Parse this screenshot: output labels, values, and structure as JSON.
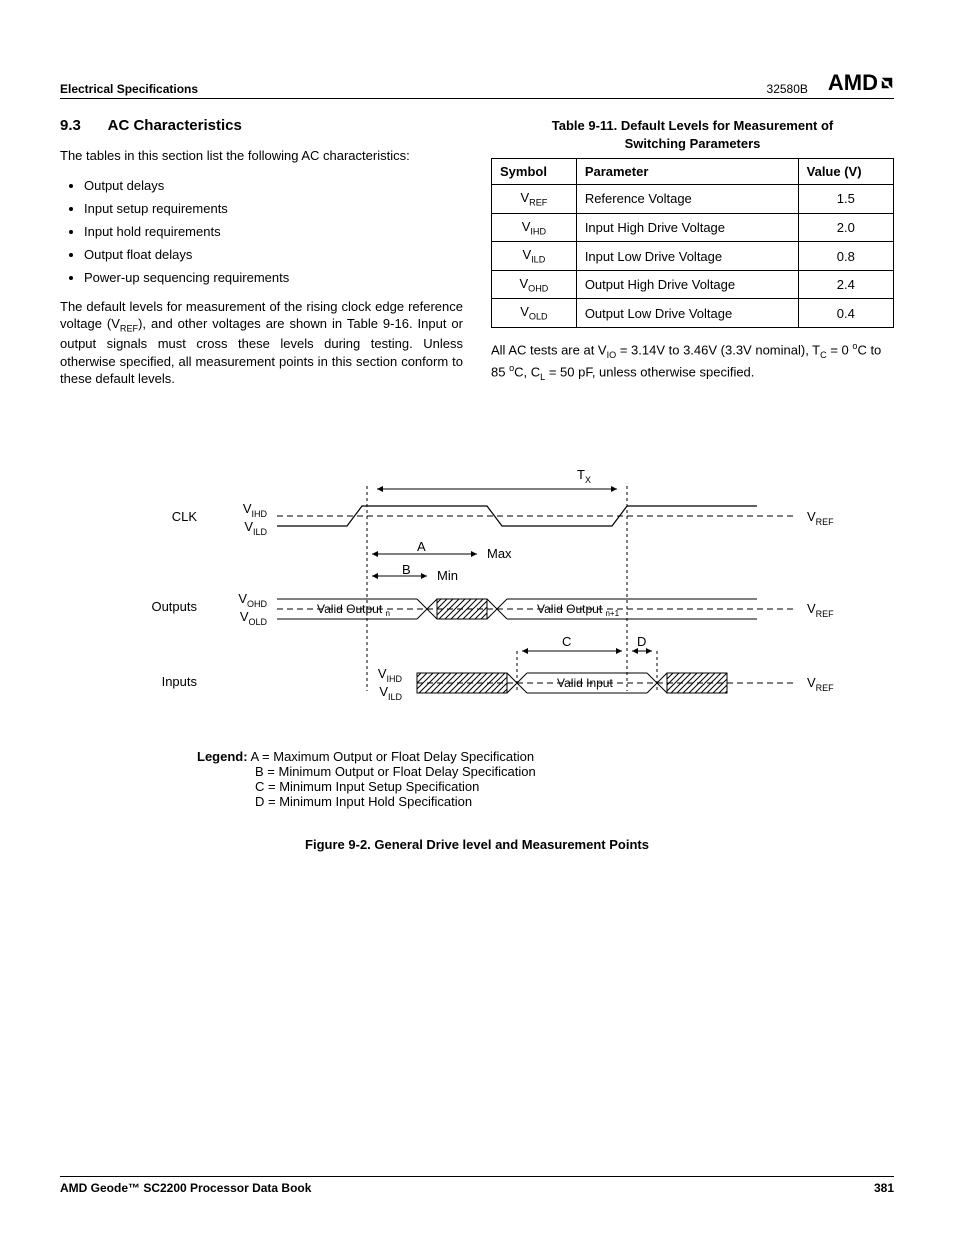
{
  "header": {
    "left": "Electrical Specifications",
    "docnum": "32580B",
    "brand": "AMD"
  },
  "footer": {
    "left": "AMD Geode™ SC2200  Processor Data Book",
    "right": "381"
  },
  "section": {
    "number": "9.3",
    "title": "AC Characteristics",
    "intro": "The tables in this section list the following AC characteristics:",
    "bullets": [
      "Output delays",
      "Input setup requirements",
      "Input hold requirements",
      "Output float delays",
      "Power-up sequencing requirements"
    ],
    "para2_a": "The default levels for measurement of the rising clock edge reference voltage (V",
    "para2_sub": "REF",
    "para2_b": "), and other voltages are shown in Table 9-16. Input or output signals must cross these levels during testing. Unless otherwise specified, all measurement points in this section conform to these default levels."
  },
  "table": {
    "caption_a": "Table 9-11.  Default Levels for Measurement of",
    "caption_b": "Switching Parameters",
    "headers": {
      "c1": "Symbol",
      "c2": "Parameter",
      "c3": "Value (V)"
    },
    "rows": [
      {
        "sym_main": "V",
        "sym_sub": "REF",
        "param": "Reference Voltage",
        "val": "1.5"
      },
      {
        "sym_main": "V",
        "sym_sub": "IHD",
        "param": "Input High Drive Voltage",
        "val": "2.0"
      },
      {
        "sym_main": "V",
        "sym_sub": "ILD",
        "param": "Input Low Drive Voltage",
        "val": "0.8"
      },
      {
        "sym_main": "V",
        "sym_sub": "OHD",
        "param": "Output High Drive Voltage",
        "val": "2.4"
      },
      {
        "sym_main": "V",
        "sym_sub": "OLD",
        "param": "Output Low Drive Voltage",
        "val": "0.4"
      }
    ],
    "note_a": "All AC tests are at V",
    "note_sub1": "IO",
    "note_b": " = 3.14V to 3.46V (3.3V nominal), T",
    "note_sub2": "C",
    "note_c": " = 0 ",
    "note_deg1": "o",
    "note_d": "C to 85 ",
    "note_deg2": "o",
    "note_e": "C, C",
    "note_sub3": "L",
    "note_f": " = 50 pF, unless otherwise specified."
  },
  "figure": {
    "labels": {
      "tx_t": "T",
      "tx_sub": "X",
      "clk": "CLK",
      "vihd_v": "V",
      "vihd_s": "IHD",
      "vild_v": "V",
      "vild_s": "ILD",
      "vohd_v": "V",
      "vohd_s": "OHD",
      "vold_v": "V",
      "vold_s": "OLD",
      "vref_v": "V",
      "vref_s": "REF",
      "outputs": "Outputs",
      "inputs": "Inputs",
      "valid_out_n_a": "Valid Output ",
      "valid_out_n_sub": "n",
      "valid_out_n1_a": "Valid Output ",
      "valid_out_n1_sub": "n+1",
      "valid_input": "Valid Input",
      "A": "A",
      "B": "B",
      "C": "C",
      "D": "D",
      "max": "Max",
      "min": "Min"
    },
    "legend": {
      "lead": "Legend:",
      "A": "A = Maximum Output or Float Delay Specification",
      "B": "B = Minimum Output or Float Delay Specification",
      "C": "C = Minimum Input Setup Specification",
      "D": "D = Minimum Input Hold Specification"
    },
    "caption": "Figure 9-2.  General Drive level and Measurement Points"
  }
}
